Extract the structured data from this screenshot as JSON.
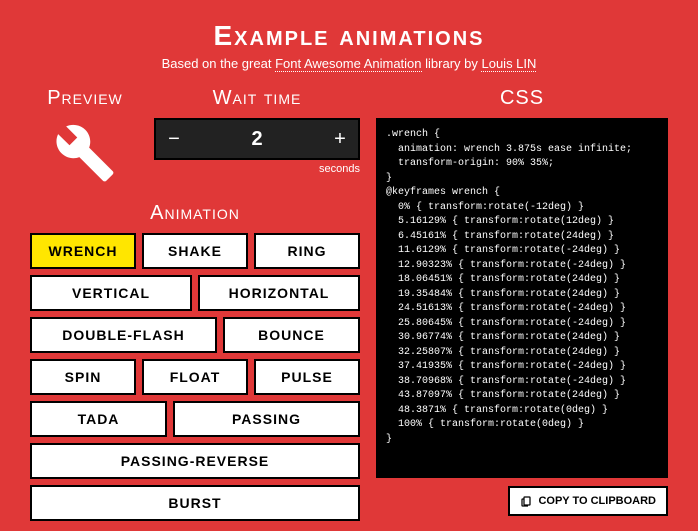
{
  "title": "Example animations",
  "subtitle": {
    "prefix": "Based on the great ",
    "lib": "Font Awesome Animation",
    "mid": " library by ",
    "author": "Louis LIN"
  },
  "labels": {
    "preview": "Preview",
    "wait": "Wait time",
    "css": "CSS",
    "animation": "Animation",
    "seconds": "seconds",
    "copy": "COPY TO CLIPBOARD"
  },
  "wait_value": "2",
  "animations": [
    "WRENCH",
    "SHAKE",
    "RING",
    "VERTICAL",
    "HORIZONTAL",
    "DOUBLE-FLASH",
    "BOUNCE",
    "SPIN",
    "FLOAT",
    "PULSE",
    "TADA",
    "PASSING",
    "PASSING-REVERSE",
    "BURST"
  ],
  "active_animation": "WRENCH",
  "css_code": ".wrench {\n  animation: wrench 3.875s ease infinite;\n  transform-origin: 90% 35%;\n}\n@keyframes wrench {\n  0% { transform:rotate(-12deg) }\n  5.16129% { transform:rotate(12deg) }\n  6.45161% { transform:rotate(24deg) }\n  11.6129% { transform:rotate(-24deg) }\n  12.90323% { transform:rotate(-24deg) }\n  18.06451% { transform:rotate(24deg) }\n  19.35484% { transform:rotate(24deg) }\n  24.51613% { transform:rotate(-24deg) }\n  25.80645% { transform:rotate(-24deg) }\n  30.96774% { transform:rotate(24deg) }\n  32.25807% { transform:rotate(24deg) }\n  37.41935% { transform:rotate(-24deg) }\n  38.70968% { transform:rotate(-24deg) }\n  43.87097% { transform:rotate(24deg) }\n  48.3871% { transform:rotate(0deg) }\n  100% { transform:rotate(0deg) }\n}"
}
